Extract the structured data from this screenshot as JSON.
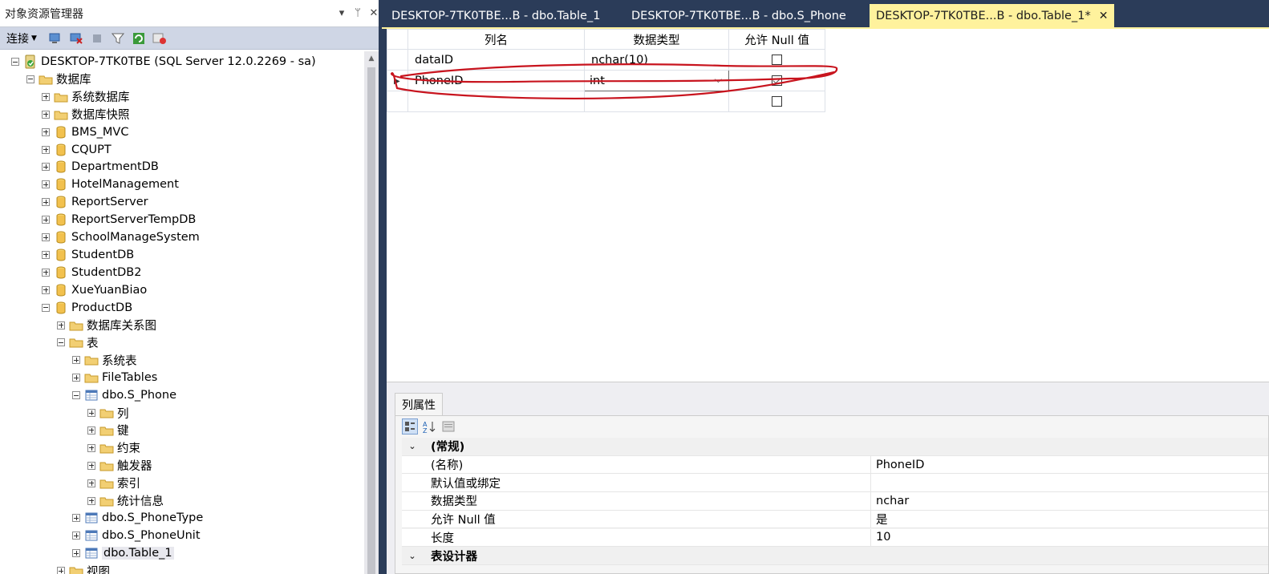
{
  "object_explorer": {
    "title": "对象资源管理器",
    "buttons": {
      "dropdown": "▾",
      "pin": "ᛘ",
      "close": "✕"
    },
    "toolbar": {
      "connect_label": "连接"
    },
    "tree": [
      {
        "label": "DESKTOP-7TK0TBE (SQL Server 12.0.2269 - sa)",
        "icon": "server-icon"
      },
      {
        "label": "数据库",
        "icon": "folder-icon"
      },
      {
        "label": "系统数据库",
        "icon": "folder-icon"
      },
      {
        "label": "数据库快照",
        "icon": "folder-icon"
      },
      {
        "label": "BMS_MVC",
        "icon": "database-icon"
      },
      {
        "label": "CQUPT",
        "icon": "database-icon"
      },
      {
        "label": "DepartmentDB",
        "icon": "database-icon"
      },
      {
        "label": "HotelManagement",
        "icon": "database-icon"
      },
      {
        "label": "ReportServer",
        "icon": "database-icon"
      },
      {
        "label": "ReportServerTempDB",
        "icon": "database-icon"
      },
      {
        "label": "SchoolManageSystem",
        "icon": "database-icon"
      },
      {
        "label": "StudentDB",
        "icon": "database-icon"
      },
      {
        "label": "StudentDB2",
        "icon": "database-icon"
      },
      {
        "label": "XueYuanBiao",
        "icon": "database-icon"
      },
      {
        "label": "ProductDB",
        "icon": "database-icon"
      },
      {
        "label": "数据库关系图",
        "icon": "folder-icon"
      },
      {
        "label": "表",
        "icon": "folder-icon"
      },
      {
        "label": "系统表",
        "icon": "folder-icon"
      },
      {
        "label": "FileTables",
        "icon": "folder-icon"
      },
      {
        "label": "dbo.S_Phone",
        "icon": "table-icon"
      },
      {
        "label": "列",
        "icon": "folder-icon"
      },
      {
        "label": "键",
        "icon": "folder-icon"
      },
      {
        "label": "约束",
        "icon": "folder-icon"
      },
      {
        "label": "触发器",
        "icon": "folder-icon"
      },
      {
        "label": "索引",
        "icon": "folder-icon"
      },
      {
        "label": "统计信息",
        "icon": "folder-icon"
      },
      {
        "label": "dbo.S_PhoneType",
        "icon": "table-icon"
      },
      {
        "label": "dbo.S_PhoneUnit",
        "icon": "table-icon"
      },
      {
        "label": "dbo.Table_1",
        "icon": "table-icon"
      },
      {
        "label": "视图",
        "icon": "folder-icon"
      }
    ]
  },
  "tabs": [
    {
      "label": "DESKTOP-7TK0TBE...B - dbo.Table_1"
    },
    {
      "label": "DESKTOP-7TK0TBE...B - dbo.S_Phone"
    },
    {
      "label": "DESKTOP-7TK0TBE...B - dbo.Table_1*",
      "close": "✕"
    }
  ],
  "designer": {
    "headers": {
      "column_name": "列名",
      "data_type": "数据类型",
      "allow_null": "允许 Null 值"
    },
    "rows": [
      {
        "name": "dataID",
        "type": "nchar(10)",
        "allow_null": false
      },
      {
        "name": "PhoneID",
        "type": "int",
        "allow_null": true
      },
      {
        "name": "",
        "type": "",
        "allow_null": false
      }
    ],
    "annotation_color": "#c8141e"
  },
  "properties": {
    "tab_label": "列属性",
    "rows": [
      {
        "kind": "category",
        "label": "(常规)",
        "value": ""
      },
      {
        "kind": "prop",
        "label": "(名称)",
        "value": "PhoneID"
      },
      {
        "kind": "prop",
        "label": "默认值或绑定",
        "value": ""
      },
      {
        "kind": "prop",
        "label": "数据类型",
        "value": "nchar"
      },
      {
        "kind": "prop",
        "label": "允许 Null 值",
        "value": "是"
      },
      {
        "kind": "prop",
        "label": "长度",
        "value": "10"
      },
      {
        "kind": "category",
        "label": "表设计器",
        "value": ""
      }
    ]
  },
  "colors": {
    "chrome": "#2b3c59",
    "active_tab": "#fff29d",
    "toolbar": "#cfd6e5"
  }
}
